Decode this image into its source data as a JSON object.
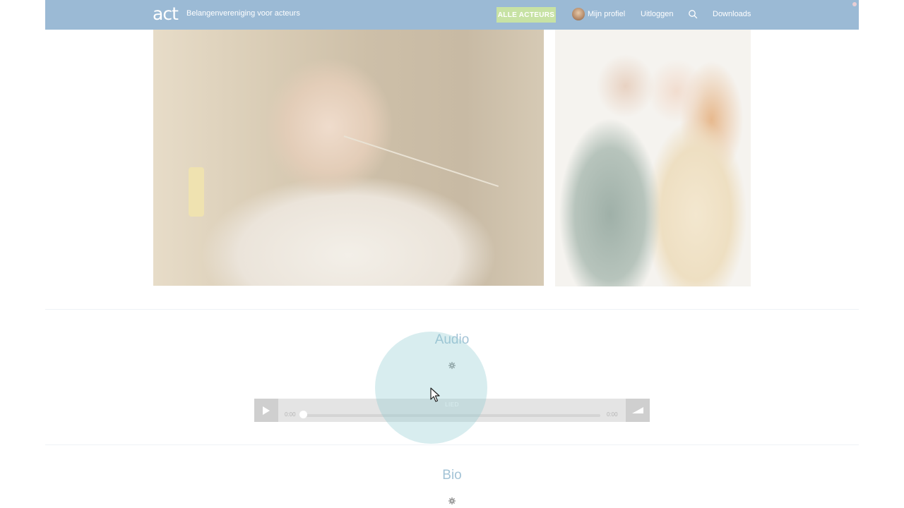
{
  "header": {
    "logo": "act",
    "tagline": "Belangenvereniging voor acteurs",
    "nav": {
      "alle_acteurs": "ALLE ACTEURS",
      "mijn_profiel": "Mijn profiel",
      "uitloggen": "Uitloggen",
      "downloads": "Downloads"
    }
  },
  "audio": {
    "title": "Audio",
    "player": {
      "track_title": "LIED",
      "current_time": "0:00",
      "duration": "0:00",
      "progress": 0
    }
  },
  "bio": {
    "title": "Bio"
  },
  "colors": {
    "navbar": "#9bbad5",
    "cta": "#c7e2a4",
    "section_title": "#a3c3d6"
  }
}
